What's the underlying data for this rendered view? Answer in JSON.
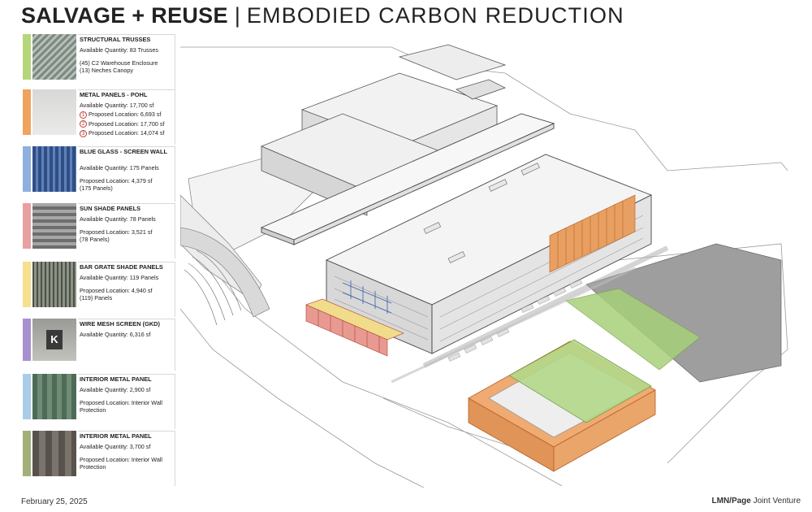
{
  "header": {
    "title_bold": "SALVAGE + REUSE",
    "separator": "|",
    "title_light": "EMBODIED CARBON REDUCTION"
  },
  "legend": [
    {
      "color": "#b5d67a",
      "heading": "STRUCTURAL TRUSSES",
      "lines": [
        "Available Quantity: 83 Trusses",
        "",
        "(45) C2 Warehouse Enclosure",
        "(13) Neches Canopy"
      ]
    },
    {
      "color": "#f0a35e",
      "heading": "METAL PANELS - POHL",
      "lines": [
        "Available Quantity: 17,700 sf"
      ],
      "numbered": [
        {
          "num": "1",
          "text": "Proposed Location: 6,693 sf"
        },
        {
          "num": "2",
          "text": "Proposed Location: 17,700 sf"
        },
        {
          "num": "3",
          "text": "Proposed Location: 14,074 sf"
        }
      ]
    },
    {
      "color": "#8fb0de",
      "heading": "BLUE GLASS - SCREEN WALL",
      "lines": [
        "",
        "Available Quantity: 175 Panels",
        "",
        "Proposed Location: 4,379 sf",
        "(175 Panels)"
      ]
    },
    {
      "color": "#e8a0a0",
      "heading": "SUN SHADE PANELS",
      "lines": [
        "Available Quantity: 78 Panels",
        "",
        "Proposed Location: 3,521 sf",
        "(78 Panels)"
      ]
    },
    {
      "color": "#f5e08e",
      "heading": "BAR GRATE SHADE PANELS",
      "lines": [
        "Available Quantity: 119 Panels",
        "",
        "Proposed Location: 4,940 sf",
        "(119) Panels"
      ]
    },
    {
      "color": "#a88fcf",
      "heading": "WIRE MESH SCREEN (GKD)",
      "lines": [
        "Available Quantity: 6,316 sf"
      ]
    },
    {
      "color": "#a9cde8",
      "heading": "INTERIOR METAL PANEL",
      "lines": [
        "Available Quantity: 2,900 sf",
        "",
        "Proposed Location: Interior Wall",
        "Protection"
      ]
    },
    {
      "color": "#a2b07a",
      "heading": "INTERIOR METAL PANEL",
      "lines": [
        "Available Quantity: 3,700 sf",
        "",
        "Proposed Location: Interior Wall",
        "Protection"
      ]
    }
  ],
  "thumb_sign": "K",
  "footer": {
    "date": "February 25, 2025",
    "firm_bold": "LMN/Page",
    "firm_rest": "Joint Venture"
  }
}
